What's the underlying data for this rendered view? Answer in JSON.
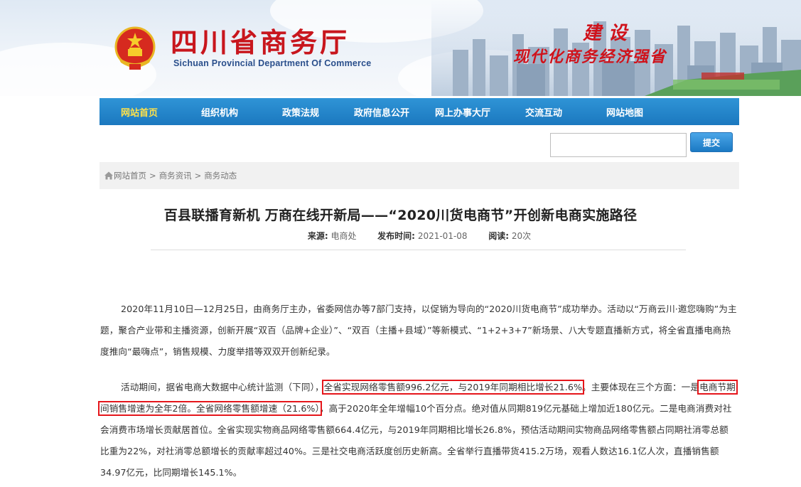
{
  "header": {
    "site_title": "四川省商务厅",
    "site_subtitle": "Sichuan Provincial Department Of Commerce",
    "slogan_line1": "建设",
    "slogan_line2": "现代化商务经济强省",
    "emblem_icon": "national-emblem-icon"
  },
  "nav": {
    "items": [
      "网站首页",
      "组织机构",
      "政策法规",
      "政府信息公开",
      "网上办事大厅",
      "交流互动",
      "网站地图"
    ],
    "active_index": 0,
    "bg_color": "#1f7fc6",
    "active_color": "#ffe14a"
  },
  "search": {
    "placeholder": "",
    "button_label": "提交"
  },
  "breadcrumb": {
    "home_icon": "home-icon",
    "items": [
      "网站首页",
      "商务资讯",
      "商务动态"
    ],
    "separator": ">"
  },
  "article": {
    "title": "百县联播育新机 万商在线开新局——“2020川货电商节”开创新电商实施路径",
    "source_label": "来源:",
    "source": "电商处",
    "date_label": "发布时间:",
    "date": "2021-01-08",
    "views_label": "阅读:",
    "views": "20次",
    "p1": "2020年11月10日—12月25日，由商务厅主办，省委网信办等7部门支持，以促销为导向的“2020川货电商节”成功举办。活动以“万商云川·邀您嗨购”为主题，聚合产业带和主播资源，创新开展“双百（品牌+企业）”、“双百（主播+县域）”等新模式、“1+2+3+7”新场景、八大专题直播新方式，将全省直播电商热度推向“最嗨点”，销售规模、力度举措等双双开创新纪录。",
    "p2_a": "活动期间，据省电商大数据中心统计监测（下同），",
    "p2_hl1": "全省实现网络零售额996.2亿元，与2019年同期相比增长21.6%",
    "p2_b": "。主要体现在三个方面：一是",
    "p2_hl2": "电商节期间销售增速为全年2倍。全省网络零售额增速（21.6%）",
    "p2_c": "，高于2020年全年增幅10个百分点。绝对值从同期819亿元基础上增加近180亿元。二是电商消费对社会消费市场增长贡献居首位。全省实现实物商品网络零售额664.4亿元，与2019年同期相比增长26.8%，预估活动期间实物商品网络零售额占同期社消零总额比重为22%，对社消零总额增长的贡献率超过40%。三是社交电商活跃度创历史新高。全省举行直播带货415.2万场，观看人数达16.1亿人次，直播销售额34.97亿元，比同期增长145.1%。",
    "highlight_color": "#e5161b"
  }
}
